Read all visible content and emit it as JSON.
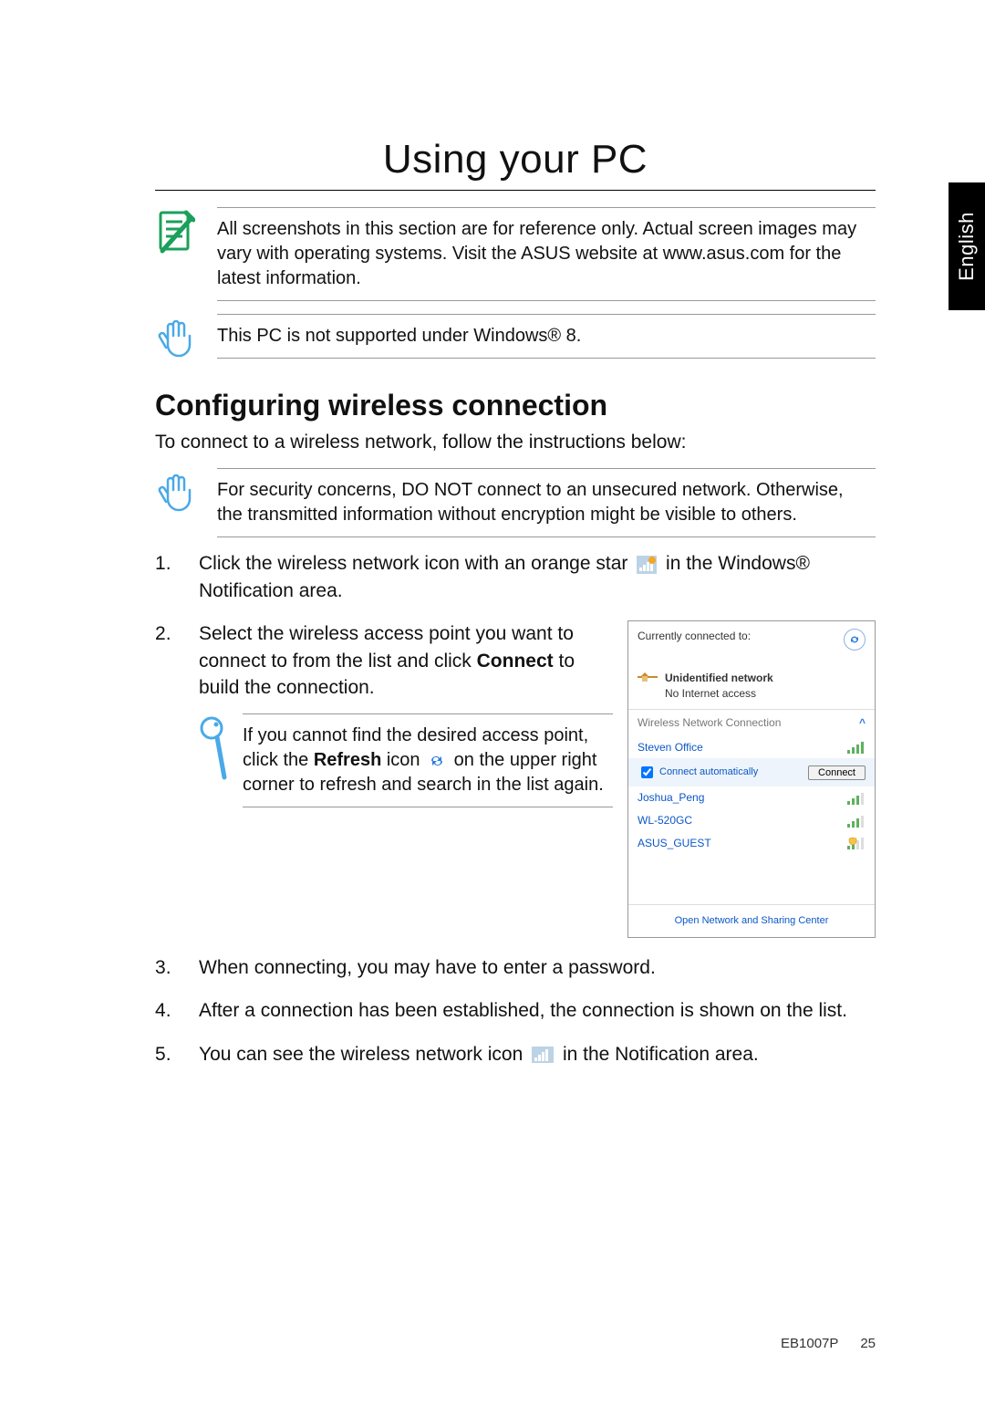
{
  "thumb_tab": {
    "language": "English"
  },
  "chapter": {
    "title": "Using your PC"
  },
  "note1": {
    "text": "All screenshots in this section are for reference only. Actual screen images may vary with operating systems. Visit the ASUS website at www.asus.com for the latest information."
  },
  "note2": {
    "text": "This PC is not supported under Windows® 8."
  },
  "section": {
    "heading": "Configuring wireless connection",
    "intro": "To connect to a wireless network, follow the instructions below:"
  },
  "note3": {
    "text": "For security concerns, DO NOT connect to an unsecured network. Otherwise, the transmitted information without encryption might be visible to others."
  },
  "steps": {
    "s1a": "Click the wireless network icon with an orange star ",
    "s1b": " in the Windows® Notification area.",
    "s2a": "Select the wireless access point you want to connect to from the list and click ",
    "s2b_emph": "Connect",
    "s2c": " to build the connection.",
    "s3": "When connecting, you may have to enter a password.",
    "s4": "After a connection has been established, the connection is shown on the list.",
    "s5a": "You can see the wireless network icon ",
    "s5b": " in the Notification area."
  },
  "tip": {
    "t1": "If you cannot find the desired access point, click the ",
    "t1_emph": "Refresh",
    "t2": " icon ",
    "t3": " on the upper right corner to refresh and search in the list again."
  },
  "wifi_popup": {
    "currently_label": "Currently connected to:",
    "unidentified": "Unidentified network",
    "no_access": "No Internet access",
    "wnc_label": "Wireless Network Connection",
    "networks": {
      "n0": "Steven Office",
      "n1": "Joshua_Peng",
      "n2": "WL-520GC",
      "n3": "ASUS_GUEST"
    },
    "connect_auto": "Connect automatically",
    "connect_btn": "Connect",
    "footer_link": "Open Network and Sharing Center"
  },
  "pagefoot": {
    "model": "EB1007P",
    "page": "25"
  }
}
